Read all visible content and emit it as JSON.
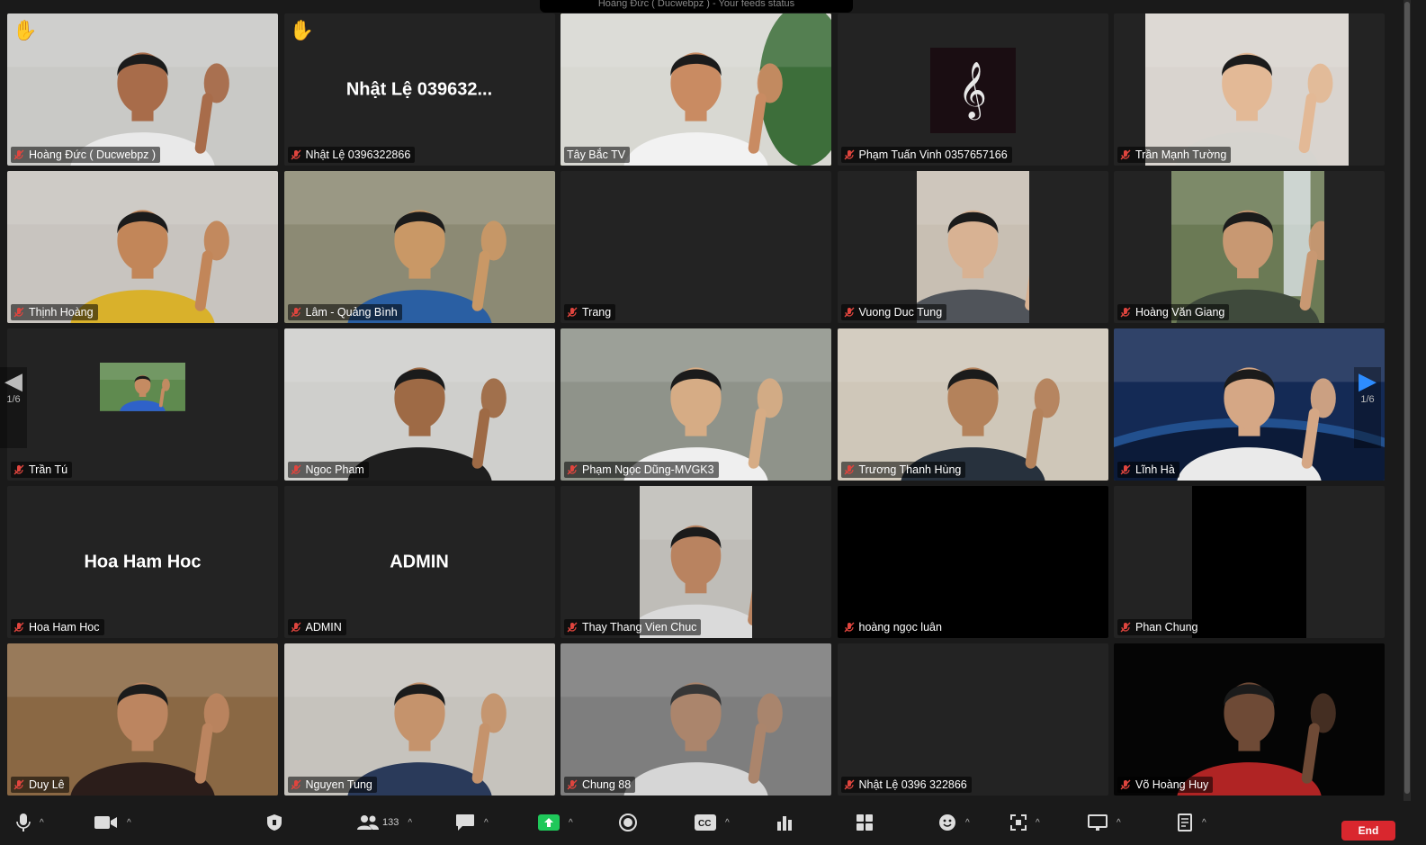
{
  "page": {
    "current": "1/6"
  },
  "top_banner_text": "Hoàng Đức ( Ducwebpz ) - Your feeds status",
  "participants": [
    {
      "name": "Hoàng Đức ( Ducwebpz )",
      "hand": true,
      "video": true,
      "bg": "#c9c9c6",
      "shirt": "#e9e9e9",
      "skin": "#a86c4a"
    },
    {
      "name": "Nhật Lệ 0396322866",
      "hand": true,
      "video": false,
      "big_name": "Nhật Lệ 039632..."
    },
    {
      "name": "Tây Bắc TV",
      "hand": false,
      "video": true,
      "active": true,
      "bg": "#d8d8d2",
      "shirt": "#f2f2f2",
      "skin": "#c98b62",
      "plant": true
    },
    {
      "name": "Phạm Tuấn Vinh 0357657166",
      "hand": false,
      "video": false,
      "avatar": "music"
    },
    {
      "name": "Trần Mạnh Tường",
      "hand": false,
      "video": true,
      "bg": "#d9d4cf",
      "shirt": "#d6d4cf",
      "skin": "#e3b996",
      "narrow": true
    },
    {
      "name": "Thịnh Hoàng",
      "hand": false,
      "video": true,
      "bg": "#c8c4bf",
      "shirt": "#d9b12b",
      "skin": "#c28659"
    },
    {
      "name": "Lâm - Quảng Bình",
      "hand": false,
      "video": true,
      "bg": "#8c8a74",
      "shirt": "#2a5fa3",
      "skin": "#c99866"
    },
    {
      "name": "Trang",
      "hand": false,
      "video": false
    },
    {
      "name": "Vuong Duc Tung",
      "hand": false,
      "video": true,
      "bg": "#c8bfb3",
      "shirt": "#50545a",
      "skin": "#d8b293",
      "narrow": true
    },
    {
      "name": "Hoàng Văn Giang",
      "hand": false,
      "video": true,
      "bg": "#6b7a55",
      "shirt": "#3f4a3c",
      "skin": "#c89872",
      "narrow": true,
      "waterfall": true
    },
    {
      "name": "Trần Tú",
      "hand": false,
      "video": false,
      "avatar": "photo"
    },
    {
      "name": "Ngoc Pham",
      "hand": false,
      "video": true,
      "bg": "#cfcfcc",
      "shirt": "#1e1e1e",
      "skin": "#9e6a45"
    },
    {
      "name": "Phạm Ngọc Dũng-MVGK3",
      "hand": false,
      "video": true,
      "bg": "#8f938a",
      "shirt": "#efefef",
      "skin": "#d6ac85"
    },
    {
      "name": "Trương Thanh Hùng",
      "hand": false,
      "video": true,
      "bg": "#cfc7b9",
      "shirt": "#27313d",
      "skin": "#b4825b"
    },
    {
      "name": "Lĩnh Hà",
      "hand": false,
      "video": true,
      "bg": "#142a55",
      "shirt": "#eaeaea",
      "skin": "#d5a785",
      "space": true
    },
    {
      "name": "Hoa Ham Hoc",
      "hand": false,
      "video": false,
      "big_name": "Hoa Ham Hoc"
    },
    {
      "name": "ADMIN",
      "hand": false,
      "video": false,
      "big_name": "ADMIN"
    },
    {
      "name": "Thay Thang Vien Chuc",
      "hand": false,
      "video": true,
      "bg": "#bfbdb8",
      "shirt": "#dadada",
      "skin": "#b98360",
      "narrow": true
    },
    {
      "name": "hoàng ngọc luân",
      "hand": false,
      "video": false,
      "black": "full"
    },
    {
      "name": "Phan Chung",
      "hand": false,
      "video": false,
      "black": "center"
    },
    {
      "name": "Duy Lê",
      "hand": false,
      "video": true,
      "bg": "#8a6844",
      "shirt": "#2b1d1a",
      "skin": "#bc8560"
    },
    {
      "name": "Nguyen Tung",
      "hand": false,
      "video": true,
      "bg": "#c6c3bd",
      "shirt": "#2a3a5a",
      "skin": "#c5936c"
    },
    {
      "name": "Chung 88",
      "hand": false,
      "video": true,
      "bg": "#7b7b7b",
      "shirt": "#f0f0f0",
      "skin": "#b78563",
      "blur": true
    },
    {
      "name": "Nhật Lệ 0396 322866",
      "hand": false,
      "video": false
    },
    {
      "name": "Võ Hoàng Huy",
      "hand": false,
      "video": true,
      "bg": "#050505",
      "shirt": "#b02424",
      "skin": "#6e4a36",
      "dark": true
    }
  ],
  "toolbar": {
    "participants_count": "133",
    "end_label": "End",
    "icons": [
      "mic-icon",
      "video-camera-icon",
      "security-shield-icon",
      "participants-icon",
      "chat-icon",
      "share-screen-icon",
      "record-icon",
      "captions-icon",
      "polls-icon",
      "apps-grid-icon",
      "reactions-icon",
      "remote-control-icon",
      "whiteboard-icon",
      "notes-icon"
    ]
  },
  "colors": {
    "tile_bg": "#232323",
    "active_border": "#e8f266",
    "end": "#d9272e",
    "share": "#1fc85a",
    "accent": "#2d8cff",
    "hand": "#f5c518"
  }
}
